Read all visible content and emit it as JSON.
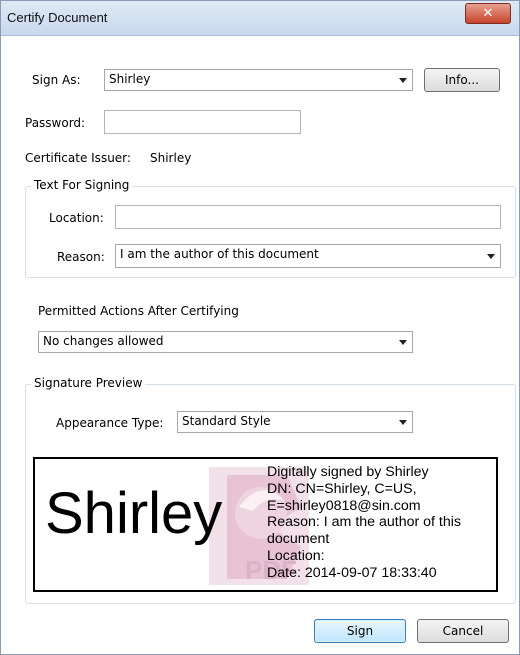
{
  "window": {
    "title": "Certify Document"
  },
  "sign_as": {
    "label": "Sign As:",
    "value": "Shirley",
    "info_button": "Info..."
  },
  "password": {
    "label": "Password:",
    "value": ""
  },
  "certificate_issuer": {
    "label": "Certificate Issuer:",
    "value": "Shirley"
  },
  "text_for_signing": {
    "legend": "Text For Signing",
    "location_label": "Location:",
    "location_value": "",
    "reason_label": "Reason:",
    "reason_value": "I am the author of this document"
  },
  "permitted_actions": {
    "label": "Permitted Actions After Certifying",
    "value": "No changes allowed"
  },
  "signature_preview": {
    "legend": "Signature Preview",
    "appearance_label": "Appearance Type:",
    "appearance_value": "Standard Style",
    "name": "Shirley",
    "watermark_text": "PDF",
    "lines": [
      "Digitally signed by Shirley",
      "DN: CN=Shirley, C=US,",
      "E=shirley0818@sin.com",
      "Reason: I am the author of this",
      "document",
      "Location:",
      "Date: 2014-09-07 18:33:40"
    ]
  },
  "buttons": {
    "sign": "Sign",
    "cancel": "Cancel"
  },
  "icons": {
    "close": "close-icon",
    "dropdown": "chevron-down-icon"
  },
  "colors": {
    "title_bar": "#c9d9ee",
    "close_button": "#c7432d",
    "primary_button": "#bee6fd"
  }
}
